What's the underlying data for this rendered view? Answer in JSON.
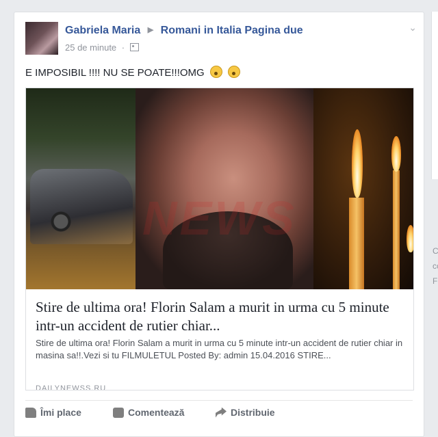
{
  "post": {
    "author": "Gabriela Maria",
    "arrow": "▶",
    "group": "Romani in Italia Pagina due",
    "time": "25 de minute",
    "dot": "·",
    "menu_icon": "chevron-down-icon",
    "status_text": "E IMPOSIBIL !!!! NU SE POATE!!!OMG"
  },
  "link_card": {
    "title": "Stire de ultima ora! Florin Salam a murit in urma cu 5 minute intr-un accident de rutier chiar...",
    "description": "Stire de ultima ora! Florin Salam a murit in urma cu 5 minute intr-un accident de rutier chiar in masina sa!!.Vezi si tu FILMULETUL Posted By: admin 15.04.2016 STIRE...",
    "source": "DAILYNEWSS.RU",
    "watermark": "NEWS"
  },
  "actions": {
    "like": "Îmi place",
    "comment": "Comentează",
    "share": "Distribuie"
  },
  "sidebar": {
    "t1": "C",
    "t2": "cc",
    "t3": "F"
  }
}
